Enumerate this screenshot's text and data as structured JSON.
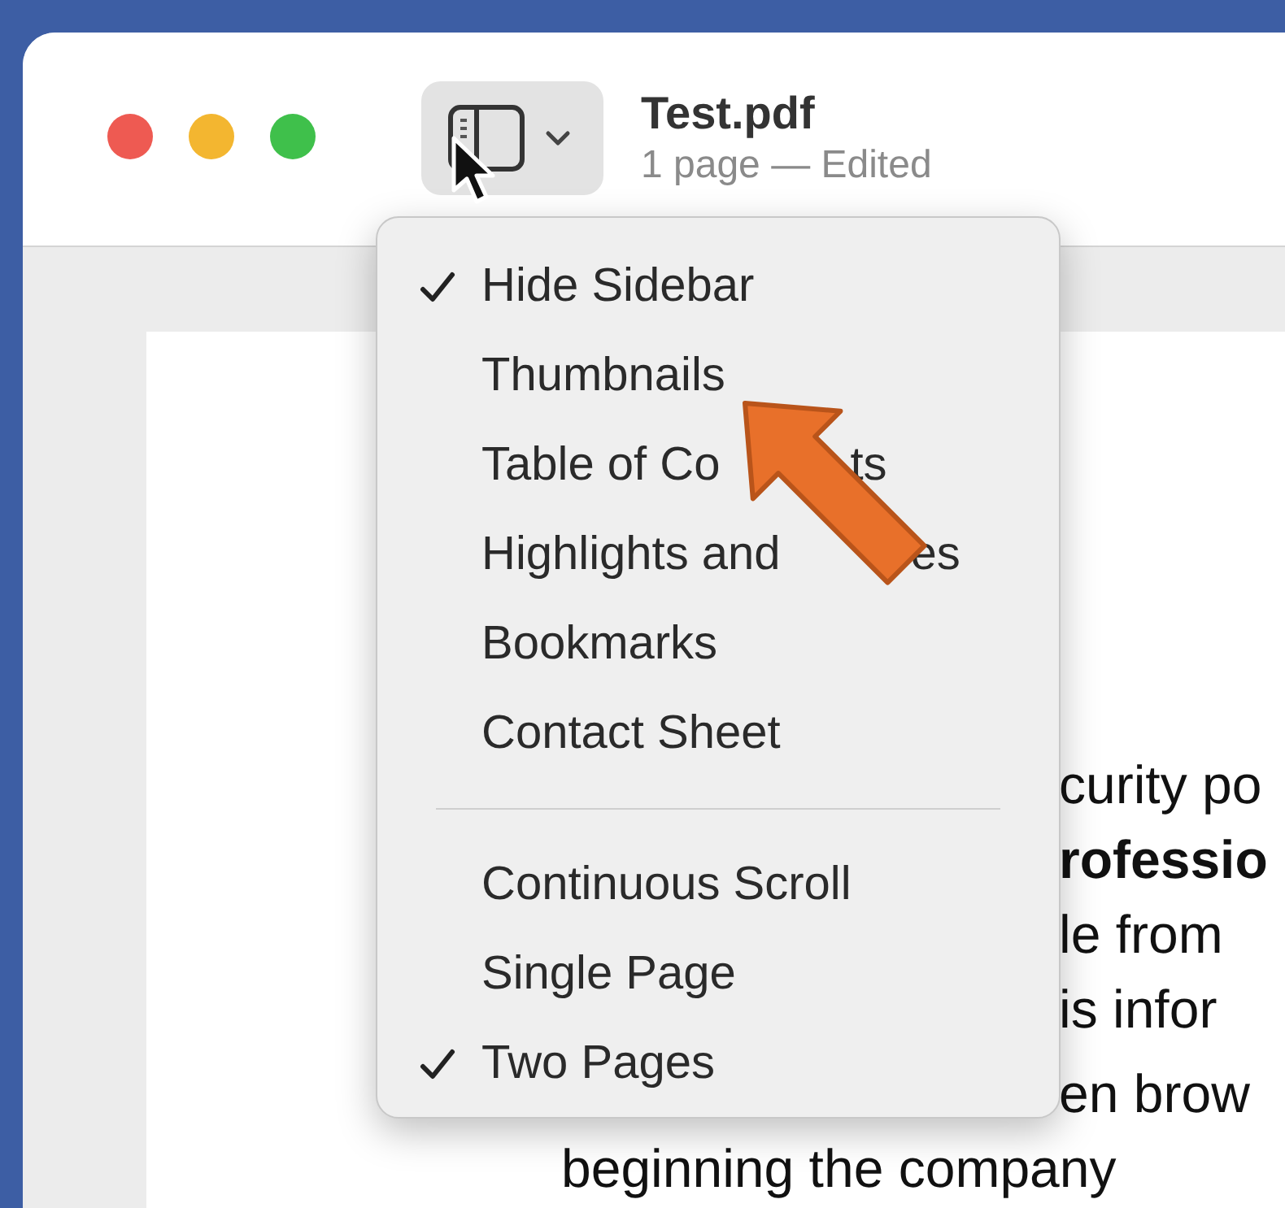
{
  "window": {
    "title": "Test.pdf",
    "subtitle": "1 page — Edited"
  },
  "sidebar_button": {
    "selected": true
  },
  "menu": {
    "items": [
      {
        "kind": "item",
        "label": "Hide Sidebar",
        "checked": true
      },
      {
        "kind": "item",
        "label": "Thumbnails",
        "checked": false
      },
      {
        "kind": "item",
        "label": "Table of Co",
        "tail": "ts",
        "checked": false
      },
      {
        "kind": "item",
        "label": "Highlights and",
        "tail": "es",
        "checked": false
      },
      {
        "kind": "item",
        "label": "Bookmarks",
        "checked": false
      },
      {
        "kind": "item",
        "label": "Contact Sheet",
        "checked": false
      },
      {
        "kind": "separator"
      },
      {
        "kind": "item",
        "label": "Continuous Scroll",
        "checked": false
      },
      {
        "kind": "item",
        "label": "Single Page",
        "checked": false
      },
      {
        "kind": "item",
        "label": "Two Pages",
        "checked": true
      }
    ]
  },
  "document": {
    "lines": [
      {
        "text": "curity po",
        "bold": false,
        "beside_menu": true
      },
      {
        "text": "rofessio",
        "bold": true,
        "beside_menu": true
      },
      {
        "text": "le from",
        "bold": false,
        "beside_menu": true
      },
      {
        "text": "is infor",
        "bold": false,
        "beside_menu": true
      },
      {
        "text": "en brow",
        "bold": false,
        "beside_menu": true
      },
      {
        "text": "beginning the company",
        "bold": false,
        "beside_menu": false
      }
    ]
  }
}
